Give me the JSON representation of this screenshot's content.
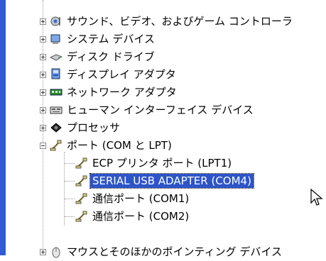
{
  "window": {
    "accent": "#2f5bd3",
    "selection_color": "#2d55c9"
  },
  "tree": {
    "items": [
      {
        "label": "サウンド、ビデオ、およびゲーム コントローラ",
        "icon": "sound-icon",
        "expander": "plus"
      },
      {
        "label": "システム デバイス",
        "icon": "system-device-icon",
        "expander": "plus"
      },
      {
        "label": "ディスク ドライブ",
        "icon": "disk-drive-icon",
        "expander": "plus"
      },
      {
        "label": "ディスプレイ アダプタ",
        "icon": "display-adapter-icon",
        "expander": "plus"
      },
      {
        "label": "ネットワーク アダプタ",
        "icon": "network-adapter-icon",
        "expander": "plus"
      },
      {
        "label": "ヒューマン インターフェイス デバイス",
        "icon": "hid-icon",
        "expander": "plus"
      },
      {
        "label": "プロセッサ",
        "icon": "processor-icon",
        "expander": "plus"
      },
      {
        "label": "ポート (COM と LPT)",
        "icon": "port-icon",
        "expander": "minus"
      },
      {
        "label": "ECP プリンタ ポート (LPT1)",
        "icon": "port-icon",
        "child": true
      },
      {
        "label": "SERIAL USB ADAPTER (COM4)",
        "icon": "port-icon",
        "child": true,
        "selected": true
      },
      {
        "label": "通信ポート (COM1)",
        "icon": "port-icon",
        "child": true
      },
      {
        "label": "通信ポート (COM2)",
        "icon": "port-icon",
        "child": true
      },
      {
        "label": "マウスとそのほかのポインティング デバイス",
        "icon": "mouse-icon",
        "expander": "plus"
      }
    ]
  }
}
